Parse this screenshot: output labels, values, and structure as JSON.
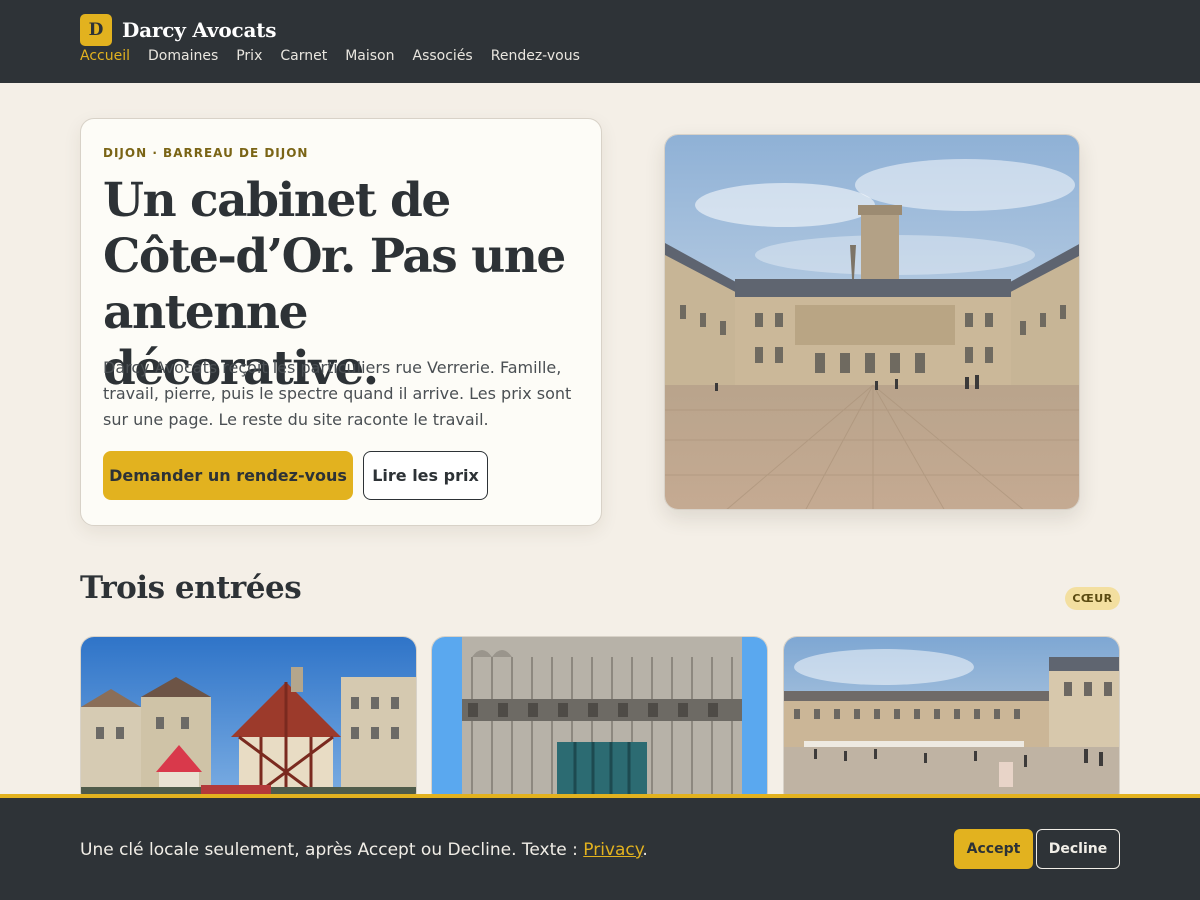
{
  "header": {
    "logo_letter": "D",
    "brand_name": "Darcy Avocats",
    "nav": [
      {
        "label": "Accueil",
        "active": true
      },
      {
        "label": "Domaines"
      },
      {
        "label": "Prix"
      },
      {
        "label": "Carnet"
      },
      {
        "label": "Maison"
      },
      {
        "label": "Associés"
      },
      {
        "label": "Rendez-vous"
      }
    ]
  },
  "hero": {
    "kicker": "DIJON · BARREAU DE DIJON",
    "title": "Un cabinet de Côte-d’Or. Pas une antenne décorative.",
    "text": "Darcy Avocats reçoit les particuliers rue Verrerie. Famille, travail, pierre, puis le spectre quand il arrive. Les prix sont sur une page. Le reste du site raconte le travail.",
    "primary_button": "Demander un rendez-vous",
    "secondary_button": "Lire les prix"
  },
  "section": {
    "title": "Trois entrées",
    "badge": "CŒUR"
  },
  "cookie": {
    "text": "Une clé locale seulement, après Accept ou Decline. Texte : ",
    "link": "Privacy",
    "period": ".",
    "accept": "Accept",
    "decline": "Decline"
  },
  "colors": {
    "accent": "#e2b21f",
    "dark": "#2e3337",
    "page_bg": "#f4efe7"
  }
}
